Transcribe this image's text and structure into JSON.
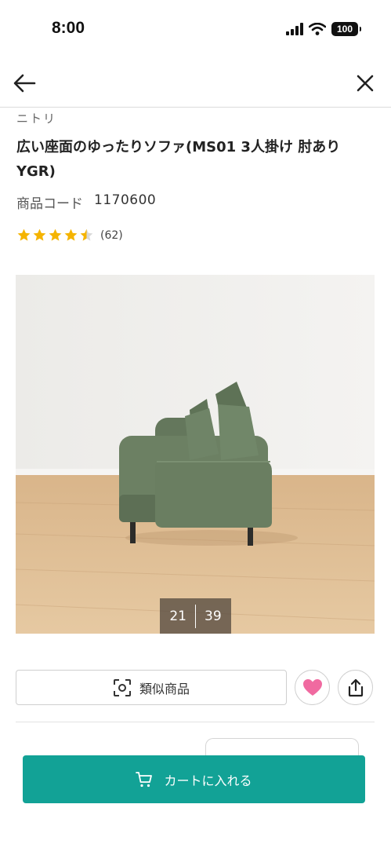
{
  "status_bar": {
    "time": "8:00",
    "battery": "100"
  },
  "product": {
    "brand": "ニトリ",
    "title": "広い座面のゆったりソファ(MS01 3人掛け 肘あり YGR)",
    "code_label": "商品コード",
    "code_value": "1170600",
    "rating": 4.5,
    "review_count": "(62)"
  },
  "gallery": {
    "current": "21",
    "total": "39"
  },
  "actions": {
    "similar_label": "類似商品",
    "cart_label": "カートに入れる"
  },
  "colors": {
    "accent": "#12a296",
    "star": "#f5b400",
    "heart": "#f06aa0"
  }
}
